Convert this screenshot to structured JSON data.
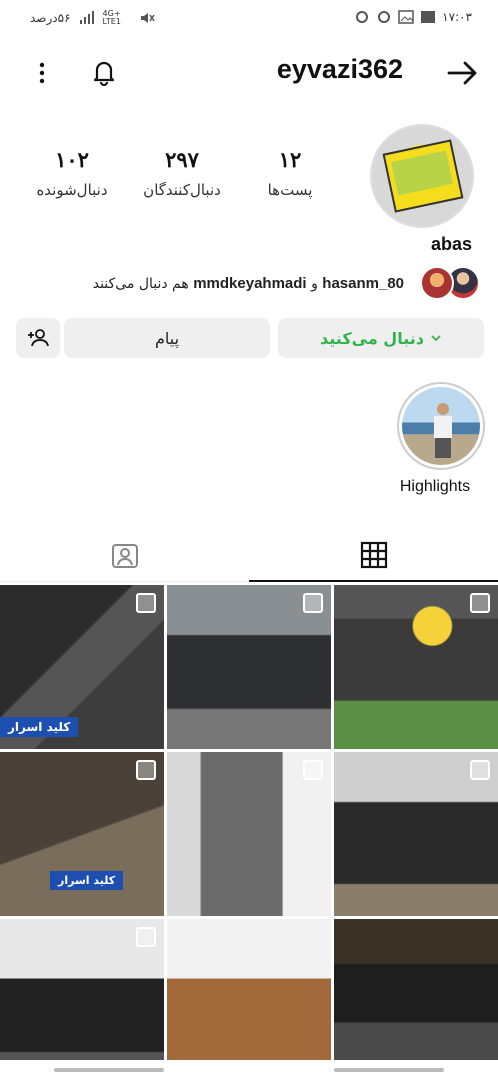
{
  "status_bar": {
    "time": "۱۷:۰۳",
    "battery": "۵۶درصد",
    "network": "4G+ LTE1"
  },
  "header": {
    "username": "eyvazi362",
    "back_icon": "arrow-right-icon",
    "bell_icon": "bell-icon",
    "menu_icon": "more-vertical-icon"
  },
  "profile": {
    "display_name": "abas",
    "stats": [
      {
        "value": "۱۲",
        "label": "پست‌ها"
      },
      {
        "value": "۲۹۷",
        "label": "دنبال‌کنندگان"
      },
      {
        "value": "۱۰۲",
        "label": "دنبال‌شونده"
      }
    ],
    "followed_by": {
      "user1": "hasanm_80",
      "connector": "و",
      "user2": "mmdkeyahmadi",
      "suffix": "هم دنبال می‌کنند"
    }
  },
  "actions": {
    "follow_label": "دنبال می‌کنید",
    "message_label": "پیام",
    "follow_color": "#2fb34a"
  },
  "highlights": [
    {
      "label": "Highlights"
    }
  ],
  "tabs": [
    {
      "icon": "grid-icon",
      "active": true
    },
    {
      "icon": "tagged-person-icon",
      "active": false
    }
  ],
  "posts": [
    {
      "badge": "کلید اسرار",
      "multiple": true
    },
    {
      "badge": "",
      "multiple": true
    },
    {
      "badge": "",
      "multiple": true
    },
    {
      "badge": "کلید اسرار",
      "multiple": true
    },
    {
      "badge": "",
      "multiple": true
    },
    {
      "badge": "",
      "multiple": true
    },
    {
      "badge": "",
      "multiple": true
    },
    {
      "badge": "",
      "multiple": false
    },
    {
      "badge": "",
      "multiple": false
    }
  ]
}
